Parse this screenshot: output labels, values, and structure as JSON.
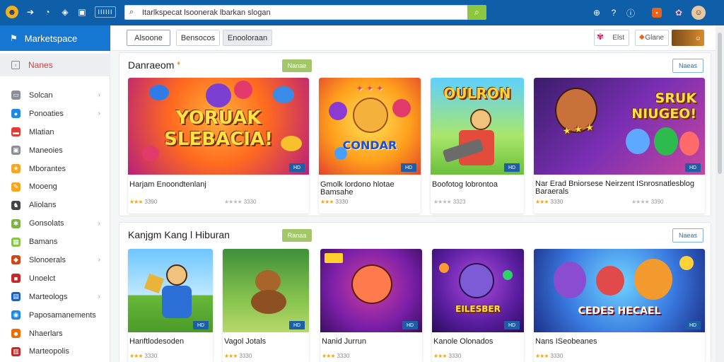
{
  "topbar": {
    "search_value": "Itarlkspecat lsoonerak lbarkan slogan",
    "icons_left": [
      "logo-icon",
      "forward-icon",
      "clock-icon",
      "shield-icon",
      "chat-icon"
    ],
    "grid_label": "IIIIII",
    "icons_right": [
      "globe-icon",
      "help-icon",
      "info-icon",
      "gift-icon",
      "character-icon",
      "user-avatar"
    ]
  },
  "sidebar": {
    "title": "Marketspace",
    "active_item": "Nanes",
    "items": [
      {
        "label": "Solcan",
        "icon": "folder-icon",
        "color": "#8a8f96",
        "chevron": true
      },
      {
        "label": "Ponoaties",
        "icon": "pin-icon",
        "color": "#1e88e5",
        "chevron": true
      },
      {
        "label": "Mlatian",
        "icon": "flag-icon",
        "color": "#e53935",
        "chevron": false
      },
      {
        "label": "Maneoies",
        "icon": "box-icon",
        "color": "#8a8f96",
        "chevron": false
      },
      {
        "label": "Mborantes",
        "icon": "star-icon",
        "color": "#f5a623",
        "chevron": false
      },
      {
        "label": "Mooeng",
        "icon": "pencil-icon",
        "color": "#f5a623",
        "chevron": false
      },
      {
        "label": "Aliolans",
        "icon": "people-icon",
        "color": "#444444",
        "chevron": false
      },
      {
        "label": "Gonsolats",
        "icon": "gear-icon",
        "color": "#7cb342",
        "chevron": true
      },
      {
        "label": "Bamans",
        "icon": "image-icon",
        "color": "#8bc34a",
        "chevron": false
      },
      {
        "label": "Slonoerals",
        "icon": "stack-icon",
        "color": "#d84315",
        "chevron": true
      },
      {
        "label": "Unoelct",
        "icon": "tile-icon",
        "color": "#c62828",
        "chevron": false
      },
      {
        "label": "Marteologs",
        "icon": "gamepad-icon",
        "color": "#1565c0",
        "chevron": true
      },
      {
        "label": "Paposamanements",
        "icon": "coin-icon",
        "color": "#1e88e5",
        "chevron": false
      },
      {
        "label": "Nhaerlars",
        "icon": "face-icon",
        "color": "#ef6c00",
        "chevron": false
      },
      {
        "label": "Marteopolis",
        "icon": "city-icon",
        "color": "#c62828",
        "chevron": false
      }
    ]
  },
  "filters": {
    "tabs": [
      "Alsoone",
      "Bensocos",
      "Enooloraan"
    ],
    "right_button_1": "Elst",
    "right_button_2": "Glane"
  },
  "sections": [
    {
      "title": "Danraeom",
      "badge": "Nanae",
      "more": "Naeas",
      "cards": [
        {
          "art": "YORUAK SLEBACIA!",
          "name": "Harjam Enoondtenlanj",
          "rating": "3390",
          "rating2": "3330",
          "tag": "HD"
        },
        {
          "art": "CONDAR",
          "name": "Gmolk lordono hlotae Bamsahe",
          "rating": "3330",
          "rating2": "",
          "tag": "HD"
        },
        {
          "art": "OULRON",
          "name": "Boofotog lobrontoa",
          "rating": "",
          "rating2": "3323",
          "tag": "HD"
        },
        {
          "art": "SRUK NIUGEO!",
          "name": "Nar Erad Bniorsese Neirzent ISnrosnatlesblog Baraerals",
          "rating": "3330",
          "rating2": "3390",
          "tag": "HD"
        }
      ]
    },
    {
      "title": "Kanjgm Kang l Hiburan",
      "badge": "Ranaa",
      "more": "Naeas",
      "cards": [
        {
          "art": "",
          "name": "Hanftlodesoden",
          "rating": "3330",
          "tag": "HD"
        },
        {
          "art": "",
          "name": "Vagol Jotals",
          "rating": "3330",
          "tag": "HD"
        },
        {
          "art": "",
          "name": "Nanid Jurrun",
          "rating": "3330",
          "tag": "HD"
        },
        {
          "art": "EILESBER",
          "name": "Kanole Olonados",
          "rating": "3330",
          "tag": "HD"
        },
        {
          "art": "CEDES HECAEL",
          "name": "Nans ISeobeanes",
          "rating": "3330",
          "tag": "HD"
        }
      ]
    }
  ],
  "colors": {
    "topbar": "#0f5ea8",
    "sidebar_header": "#1677d2",
    "search_button": "#8dc63f",
    "badge": "#a4c66b",
    "star": "#f0a81c"
  }
}
